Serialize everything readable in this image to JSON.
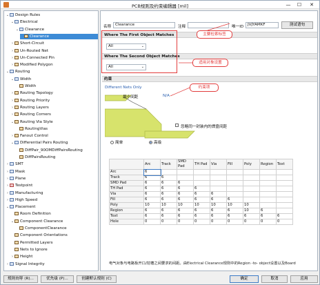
{
  "window": {
    "title": "PCB规则及约束编辑器 [mil]",
    "min": "—",
    "max": "☐",
    "close": "✕"
  },
  "tree": {
    "items": [
      {
        "label": "Design Rules",
        "exp": "⌄",
        "icon": "folder"
      },
      {
        "label": "Electrical",
        "exp": "⌄",
        "icon": "folder"
      },
      {
        "label": "Clearance",
        "exp": "⌄",
        "icon": "folder"
      },
      {
        "label": "Clearance",
        "exp": "",
        "icon": "rule"
      },
      {
        "label": "Short-Circuit",
        "exp": "›",
        "icon": "rule"
      },
      {
        "label": "Un-Routed Net",
        "exp": "›",
        "icon": "rule"
      },
      {
        "label": "Un-Connected Pin",
        "exp": "›",
        "icon": "rule"
      },
      {
        "label": "Modified Polygon",
        "exp": "›",
        "icon": "rule"
      },
      {
        "label": "Routing",
        "exp": "⌄",
        "icon": "folder"
      },
      {
        "label": "Width",
        "exp": "⌄",
        "icon": "folder"
      },
      {
        "label": "Width",
        "exp": "",
        "icon": "rule"
      },
      {
        "label": "Routing Topology",
        "exp": "›",
        "icon": "rule"
      },
      {
        "label": "Routing Priority",
        "exp": "›",
        "icon": "rule"
      },
      {
        "label": "Routing Layers",
        "exp": "›",
        "icon": "rule"
      },
      {
        "label": "Routing Corners",
        "exp": "›",
        "icon": "rule"
      },
      {
        "label": "Routing Via Style",
        "exp": "⌄",
        "icon": "rule"
      },
      {
        "label": "RoutingVias",
        "exp": "",
        "icon": "rule"
      },
      {
        "label": "Fanout Control",
        "exp": "›",
        "icon": "rule"
      },
      {
        "label": "Differential Pairs Routing",
        "exp": "⌄",
        "icon": "folder"
      },
      {
        "label": "DiffPair_90OMDiffPairsRouting",
        "exp": "",
        "icon": "rule"
      },
      {
        "label": "DiffPairsRouting",
        "exp": "",
        "icon": "rule"
      },
      {
        "label": "SMT",
        "exp": "›",
        "icon": "folder"
      },
      {
        "label": "Mask",
        "exp": "›",
        "icon": "folder"
      },
      {
        "label": "Plane",
        "exp": "›",
        "icon": "folder"
      },
      {
        "label": "Testpoint",
        "exp": "›",
        "icon": "red"
      },
      {
        "label": "Manufacturing",
        "exp": "›",
        "icon": "folder"
      },
      {
        "label": "High Speed",
        "exp": "›",
        "icon": "folder"
      },
      {
        "label": "Placement",
        "exp": "⌄",
        "icon": "folder"
      },
      {
        "label": "Room Definition",
        "exp": "",
        "icon": "rule"
      },
      {
        "label": "Component Clearance",
        "exp": "⌄",
        "icon": "rule"
      },
      {
        "label": "ComponentClearance",
        "exp": "",
        "icon": "rule"
      },
      {
        "label": "Component Orientations",
        "exp": "",
        "icon": "rule"
      },
      {
        "label": "Permitted Layers",
        "exp": "",
        "icon": "rule"
      },
      {
        "label": "Nets to Ignore",
        "exp": "",
        "icon": "rule"
      },
      {
        "label": "Height",
        "exp": "›",
        "icon": "rule"
      },
      {
        "label": "Signal Integrity",
        "exp": "›",
        "icon": "folder"
      }
    ]
  },
  "form": {
    "name_label": "名称",
    "name_value": "Clearance",
    "comment_label": "注释",
    "comment_value": "",
    "uid_label": "唯一ID",
    "uid_value": "JVJYAMKF",
    "test_button": "测试语句"
  },
  "first": {
    "title": "Where The First Object Matches",
    "select": "All"
  },
  "second": {
    "title": "Where The Second Object Matches",
    "select": "All"
  },
  "constraints": {
    "section_title": "约束",
    "diff_nets": "Different Nets Only",
    "min_clearance": "最小间距",
    "na": "N/A",
    "ignore_pad": "忽略同一封装内的焊盘间距",
    "simple": "简单",
    "advanced": "高级"
  },
  "callouts": {
    "name": "主要检索标签",
    "scope": "适用对象设置",
    "constraint": "约束项"
  },
  "grid": {
    "headers": [
      "",
      "Arc",
      "Track",
      "SMD Pad",
      "TH Pad",
      "Via",
      "Fill",
      "Poly",
      "Region",
      "Text"
    ],
    "rows": [
      {
        "name": "Arc",
        "vals": [
          "6"
        ]
      },
      {
        "name": "Track",
        "vals": [
          "6",
          "6"
        ]
      },
      {
        "name": "SMD Pad",
        "vals": [
          "6",
          "6",
          "6"
        ]
      },
      {
        "name": "TH Pad",
        "vals": [
          "6",
          "6",
          "6",
          "6"
        ]
      },
      {
        "name": "Via",
        "vals": [
          "6",
          "6",
          "6",
          "6",
          "6"
        ]
      },
      {
        "name": "Fill",
        "vals": [
          "6",
          "6",
          "6",
          "6",
          "6",
          "6"
        ]
      },
      {
        "name": "Poly",
        "vals": [
          "10",
          "10",
          "10",
          "10",
          "10",
          "10",
          "10"
        ]
      },
      {
        "name": "Region",
        "vals": [
          "6",
          "6",
          "6",
          "6",
          "6",
          "6",
          "10",
          "6"
        ]
      },
      {
        "name": "Text",
        "vals": [
          "6",
          "6",
          "6",
          "6",
          "6",
          "6",
          "6",
          "6",
          "6"
        ]
      },
      {
        "name": "Hole",
        "vals": [
          "0",
          "0",
          "0",
          "0",
          "0",
          "0",
          "0",
          "0",
          "0"
        ]
      }
    ]
  },
  "note": "电气对象与电路板开口/挖槽之间要求的间距。由Electrical Clearance规则中的Region -to- object设置以及Board",
  "buttons": {
    "wizard": "规则向导 (R)...",
    "priority": "优先级 (P)...",
    "create_default": "创建默认规则 (C)",
    "ok": "确定",
    "cancel": "取消",
    "apply": "应用"
  },
  "colors": {
    "accent": "#3d8bd6",
    "callout": "#e23b3b",
    "track": "#d7e36c"
  }
}
